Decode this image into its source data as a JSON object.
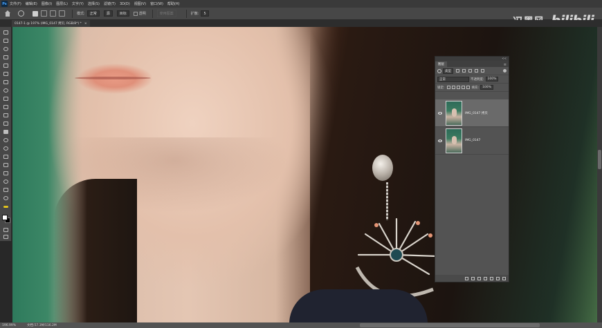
{
  "menubar": {
    "app_icon": "Ps",
    "items": [
      "文件(F)",
      "编辑(E)",
      "图像(I)",
      "图层(L)",
      "文字(Y)",
      "选择(S)",
      "滤镜(T)",
      "3D(D)",
      "视图(V)",
      "窗口(W)",
      "帮助(H)"
    ]
  },
  "options": {
    "mode_label": "模式:",
    "mode_value": "正常",
    "opacity_value": "源",
    "dest_value": "目标",
    "transparent_label": "透明",
    "use_pattern_label": "使用图案",
    "spread_label": "扩散:",
    "spread_value": "5"
  },
  "watermark": {
    "name": "冯墨风",
    "logo": "bilibili"
  },
  "document": {
    "tab_label": "0147-1 @ 197% (IMG_0147 拷贝, RGB/8*) *",
    "close_label": "×"
  },
  "statusbar": {
    "zoom": "196.99%",
    "doc_info": "文档:57.3M/116.2M"
  },
  "layers_panel": {
    "collapse": "<<",
    "tab_label": "图层",
    "menu_icon": "≡",
    "filter_kind": "类型",
    "blend_mode": "正常",
    "opacity_label": "不透明度:",
    "opacity_value": "100%",
    "lock_label": "锁定:",
    "fill_label": "填充:",
    "fill_value": "100%",
    "layers": [
      {
        "name": "IMG_0147 拷贝",
        "selected": true
      },
      {
        "name": "IMG_0147",
        "selected": false
      }
    ]
  }
}
